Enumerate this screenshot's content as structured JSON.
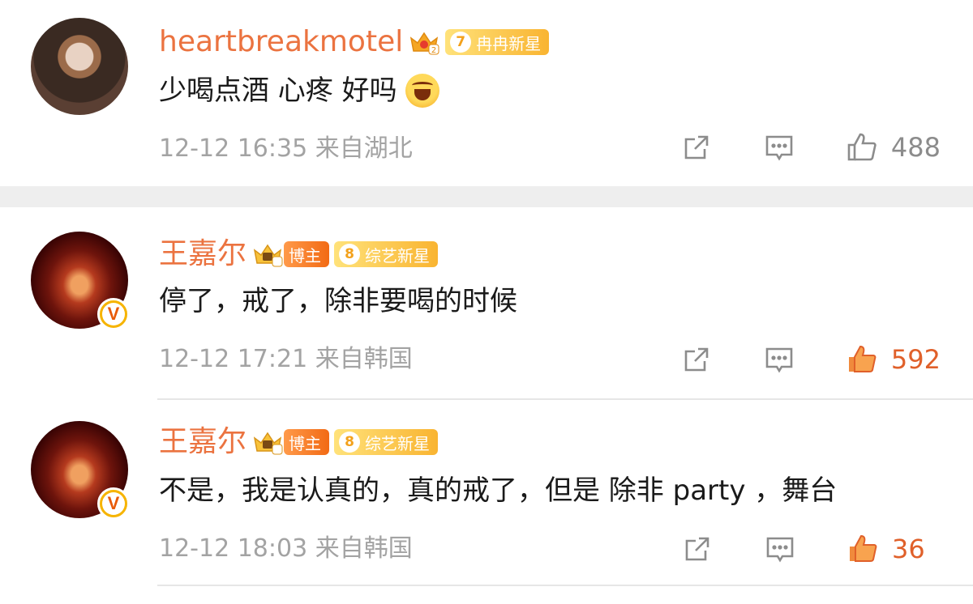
{
  "comments": [
    {
      "username": "heartbreakmotel",
      "crown_badge_icon": "crown-2-icon",
      "level_tag": {
        "level": "7",
        "label": "冉冉新星"
      },
      "text": "少喝点酒 心疼 好吗",
      "emoji_icon": "crying-face-icon",
      "timestamp": "12-12 16:35",
      "location": "来自湖北",
      "likes": "488",
      "liked": false
    },
    {
      "username": "王嘉尔",
      "crown_badge_icon": "crown-gold-icon",
      "role_tag": "博主",
      "level_tag": {
        "level": "8",
        "label": "综艺新星"
      },
      "text": "停了，戒了，除非要喝的时候",
      "verified_icon": "verified-v-icon",
      "timestamp": "12-12 17:21",
      "location": "来自韩国",
      "likes": "592",
      "liked": true
    },
    {
      "username": "王嘉尔",
      "crown_badge_icon": "crown-gold-icon",
      "role_tag": "博主",
      "level_tag": {
        "level": "8",
        "label": "综艺新星"
      },
      "text": "不是，我是认真的，真的戒了，但是 除非 party ，舞台",
      "verified_icon": "verified-v-icon",
      "timestamp": "12-12 18:03",
      "location": "来自韩国",
      "likes": "36",
      "liked": true
    }
  ],
  "colors": {
    "username": "#eb7340",
    "like_active": "#e0602a",
    "meta_gray": "#a3a3a3",
    "divider": "#eeeeee"
  },
  "icons": {
    "share": "share-icon",
    "reply": "comment-icon",
    "like": "thumbs-up-icon",
    "verified_letter": "V"
  }
}
